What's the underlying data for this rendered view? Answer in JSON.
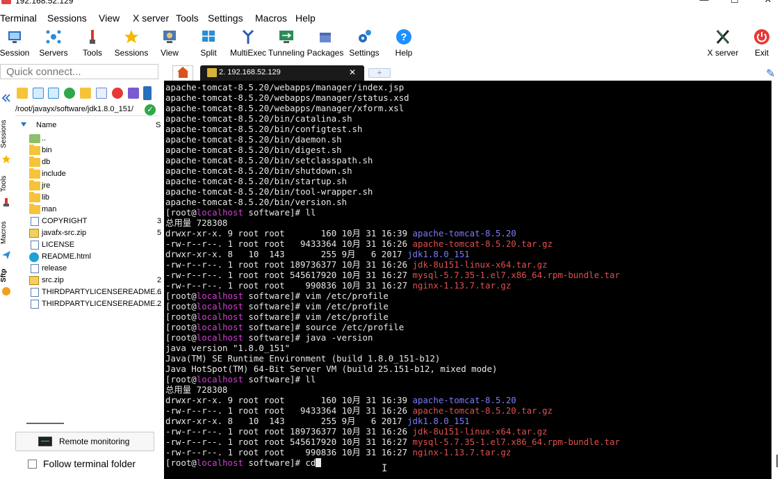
{
  "window": {
    "title": "192.168.52.129",
    "minimize_glyph": "—",
    "maximize_glyph": "☐",
    "close_glyph": "✕"
  },
  "menu": [
    "Terminal",
    "Sessions",
    "View",
    "X server",
    "Tools",
    "Settings",
    "Macros",
    "Help"
  ],
  "toolbar": {
    "buttons": [
      {
        "label": "Session",
        "icon": "session-icon"
      },
      {
        "label": "Servers",
        "icon": "servers-icon"
      },
      {
        "label": "Tools",
        "icon": "tools-icon"
      },
      {
        "label": "Sessions",
        "icon": "star-icon"
      },
      {
        "label": "View",
        "icon": "view-icon"
      },
      {
        "label": "Split",
        "icon": "split-icon"
      },
      {
        "label": "MultiExec",
        "icon": "multiexec-icon"
      },
      {
        "label": "Tunneling",
        "icon": "tunneling-icon"
      },
      {
        "label": "Packages",
        "icon": "packages-icon"
      },
      {
        "label": "Settings",
        "icon": "gear-icon"
      },
      {
        "label": "Help",
        "icon": "help-icon"
      }
    ],
    "xserver_label": "X server",
    "exit_label": "Exit"
  },
  "quick_connect": {
    "placeholder": "Quick connect..."
  },
  "side_tabs": [
    "Sessions",
    "Tools",
    "Macros",
    "Sftp"
  ],
  "sftp": {
    "path": "/root/javayx/software/jdk1.8.0_151/",
    "column_name": "Name",
    "column_size": "S",
    "files": [
      {
        "name": "..",
        "type": "up",
        "size": ""
      },
      {
        "name": "bin",
        "type": "folder",
        "size": ""
      },
      {
        "name": "db",
        "type": "folder",
        "size": ""
      },
      {
        "name": "include",
        "type": "folder",
        "size": ""
      },
      {
        "name": "jre",
        "type": "folder",
        "size": ""
      },
      {
        "name": "lib",
        "type": "folder",
        "size": ""
      },
      {
        "name": "man",
        "type": "folder",
        "size": ""
      },
      {
        "name": "COPYRIGHT",
        "type": "file",
        "size": "3"
      },
      {
        "name": "javafx-src.zip",
        "type": "zip",
        "size": "5"
      },
      {
        "name": "LICENSE",
        "type": "file",
        "size": ""
      },
      {
        "name": "README.html",
        "type": "edge",
        "size": ""
      },
      {
        "name": "release",
        "type": "file",
        "size": ""
      },
      {
        "name": "src.zip",
        "type": "zip",
        "size": "2"
      },
      {
        "name": "THIRDPARTYLICENSEREADME...",
        "type": "file",
        "size": "6"
      },
      {
        "name": "THIRDPARTYLICENSEREADME...",
        "type": "file",
        "size": "2"
      }
    ],
    "remote_monitoring_label": "Remote monitoring",
    "follow_folder_label": "Follow terminal folder"
  },
  "tabs": {
    "session_title": "2. 192.168.52.129",
    "close_glyph": "✕",
    "new_tab_glyph": "+"
  },
  "terminal": {
    "lines": [
      [
        {
          "t": "apache-tomcat-8.5.20/webapps/manager/index.jsp"
        }
      ],
      [
        {
          "t": "apache-tomcat-8.5.20/webapps/manager/status.xsd"
        }
      ],
      [
        {
          "t": "apache-tomcat-8.5.20/webapps/manager/xform.xsl"
        }
      ],
      [
        {
          "t": "apache-tomcat-8.5.20/bin/catalina.sh"
        }
      ],
      [
        {
          "t": "apache-tomcat-8.5.20/bin/configtest.sh"
        }
      ],
      [
        {
          "t": "apache-tomcat-8.5.20/bin/daemon.sh"
        }
      ],
      [
        {
          "t": "apache-tomcat-8.5.20/bin/digest.sh"
        }
      ],
      [
        {
          "t": "apache-tomcat-8.5.20/bin/setclasspath.sh"
        }
      ],
      [
        {
          "t": "apache-tomcat-8.5.20/bin/shutdown.sh"
        }
      ],
      [
        {
          "t": "apache-tomcat-8.5.20/bin/startup.sh"
        }
      ],
      [
        {
          "t": "apache-tomcat-8.5.20/bin/tool-wrapper.sh"
        }
      ],
      [
        {
          "t": "apache-tomcat-8.5.20/bin/version.sh"
        }
      ],
      [
        {
          "t": "[root@"
        },
        {
          "t": "localhost",
          "c": "host"
        },
        {
          "t": " software]# ll"
        }
      ],
      [
        {
          "t": "总用量 728308"
        }
      ],
      [
        {
          "t": "drwxr-xr-x. 9 root root       160 10月 31 16:39 "
        },
        {
          "t": "apache-tomcat-8.5.20",
          "c": "dirc"
        }
      ],
      [
        {
          "t": "-rw-r--r--. 1 root root   9433364 10月 31 16:26 "
        },
        {
          "t": "apache-tomcat-8.5.20.tar.gz",
          "c": "red"
        }
      ],
      [
        {
          "t": "drwxr-xr-x. 8   10  143       255 9月   6 2017 "
        },
        {
          "t": "jdk1.8.0_151",
          "c": "dirc"
        }
      ],
      [
        {
          "t": "-rw-r--r--. 1 root root 189736377 10月 31 16:26 "
        },
        {
          "t": "jdk-8u151-linux-x64.tar.gz",
          "c": "red"
        }
      ],
      [
        {
          "t": "-rw-r--r--. 1 root root 545617920 10月 31 16:27 "
        },
        {
          "t": "mysql-5.7.35-1.el7.x86_64.rpm-bundle.tar",
          "c": "red"
        }
      ],
      [
        {
          "t": "-rw-r--r--. 1 root root    990836 10月 31 16:27 "
        },
        {
          "t": "nginx-1.13.7.tar.gz",
          "c": "red"
        }
      ],
      [
        {
          "t": "[root@"
        },
        {
          "t": "localhost",
          "c": "host"
        },
        {
          "t": " software]# vim /etc/profile"
        }
      ],
      [
        {
          "t": "[root@"
        },
        {
          "t": "localhost",
          "c": "host"
        },
        {
          "t": " software]# vim /etc/profile"
        }
      ],
      [
        {
          "t": "[root@"
        },
        {
          "t": "localhost",
          "c": "host"
        },
        {
          "t": " software]# vim /etc/profile"
        }
      ],
      [
        {
          "t": "[root@"
        },
        {
          "t": "localhost",
          "c": "host"
        },
        {
          "t": " software]# source /etc/profile"
        }
      ],
      [
        {
          "t": "[root@"
        },
        {
          "t": "localhost",
          "c": "host"
        },
        {
          "t": " software]# java -version"
        }
      ],
      [
        {
          "t": "java version \"1.8.0_151\""
        }
      ],
      [
        {
          "t": "Java(TM) SE Runtime Environment (build 1.8.0_151-b12)"
        }
      ],
      [
        {
          "t": "Java HotSpot(TM) 64-Bit Server VM (build 25.151-b12, mixed mode)"
        }
      ],
      [
        {
          "t": "[root@"
        },
        {
          "t": "localhost",
          "c": "host"
        },
        {
          "t": " software]# ll"
        }
      ],
      [
        {
          "t": "总用量 728308"
        }
      ],
      [
        {
          "t": "drwxr-xr-x. 9 root root       160 10月 31 16:39 "
        },
        {
          "t": "apache-tomcat-8.5.20",
          "c": "dirc"
        }
      ],
      [
        {
          "t": "-rw-r--r--. 1 root root   9433364 10月 31 16:26 "
        },
        {
          "t": "apache-tomcat-8.5.20.tar.gz",
          "c": "red"
        }
      ],
      [
        {
          "t": "drwxr-xr-x. 8   10  143       255 9月   6 2017 "
        },
        {
          "t": "jdk1.8.0_151",
          "c": "dirc"
        }
      ],
      [
        {
          "t": "-rw-r--r--. 1 root root 189736377 10月 31 16:26 "
        },
        {
          "t": "jdk-8u151-linux-x64.tar.gz",
          "c": "red"
        }
      ],
      [
        {
          "t": "-rw-r--r--. 1 root root 545617920 10月 31 16:27 "
        },
        {
          "t": "mysql-5.7.35-1.el7.x86_64.rpm-bundle.tar",
          "c": "red"
        }
      ],
      [
        {
          "t": "-rw-r--r--. 1 root root    990836 10月 31 16:27 "
        },
        {
          "t": "nginx-1.13.7.tar.gz",
          "c": "red"
        }
      ],
      [
        {
          "t": "[root@"
        },
        {
          "t": "localhost",
          "c": "host"
        },
        {
          "t": " software]# cd"
        },
        {
          "cursor": true
        }
      ]
    ]
  },
  "colors": {
    "terminal_bg": "#000000",
    "terminal_fg": "#e8e8e8",
    "hostname": "#d43fd6",
    "directory": "#7b7bff",
    "archive": "#e05050",
    "ok_green": "#2ea84a"
  }
}
